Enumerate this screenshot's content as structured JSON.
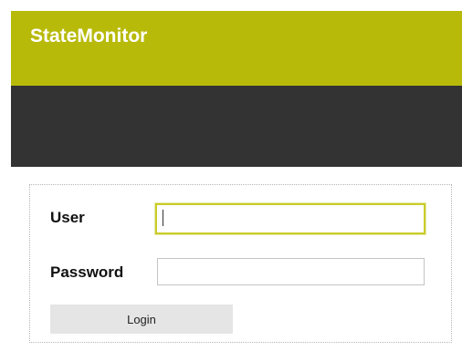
{
  "header": {
    "app_title": "StateMonitor"
  },
  "login_form": {
    "user_label": "User",
    "user_value": "",
    "password_label": "Password",
    "password_value": "",
    "login_button_label": "Login"
  },
  "colors": {
    "header_accent": "#b8ba0a",
    "dark_band": "#333333",
    "focus_border": "#c9cc2a",
    "button_background": "#e5e5e5"
  }
}
